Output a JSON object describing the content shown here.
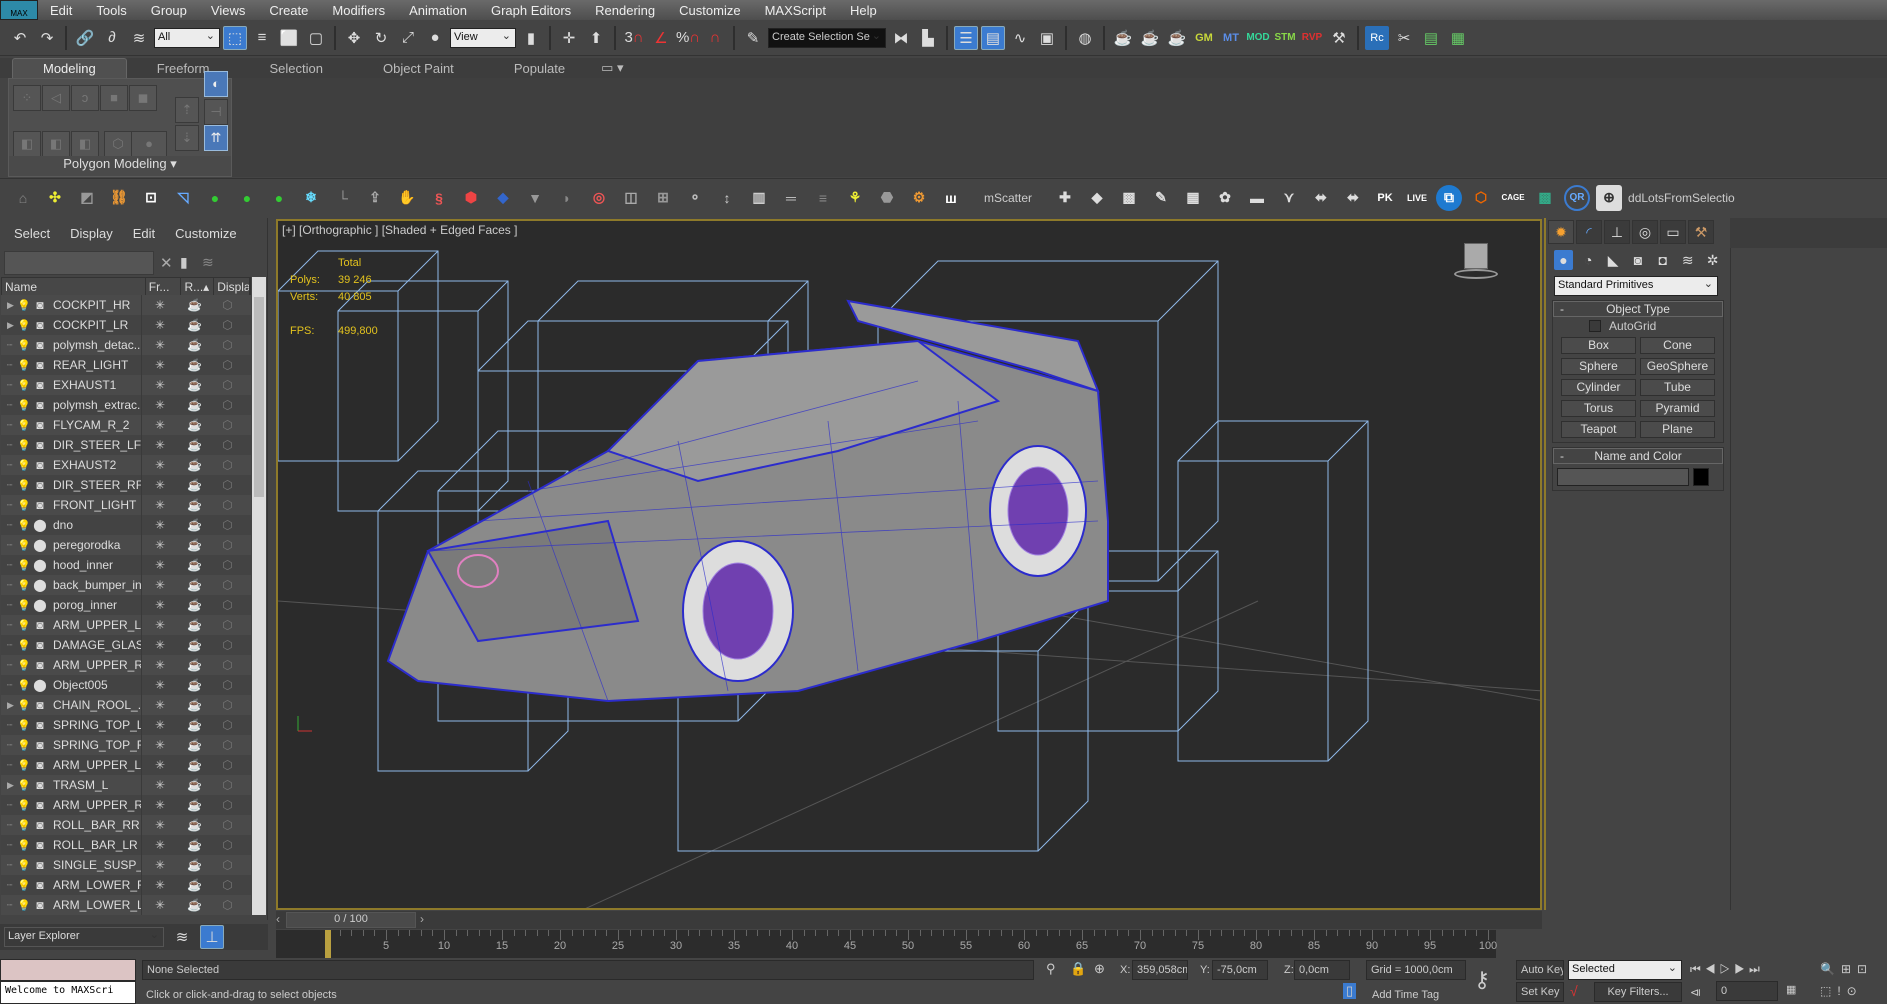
{
  "menubar": {
    "logo": "MAX",
    "items": [
      "Edit",
      "Tools",
      "Group",
      "Views",
      "Create",
      "Modifiers",
      "Animation",
      "Graph Editors",
      "Rendering",
      "Customize",
      "MAXScript",
      "Help"
    ]
  },
  "maintoolbar": {
    "selection_filter": "All",
    "ref_coord": "View",
    "named_selection": "Create Selection Se",
    "snap_labels": [
      "3",
      "%"
    ],
    "plugin_labels": [
      "GM",
      "MT",
      "MOD",
      "STM",
      "RVP",
      "Rc"
    ]
  },
  "ribbon": {
    "tabs": [
      "Modeling",
      "Freeform",
      "Selection",
      "Object Paint",
      "Populate"
    ],
    "active_tab": "Modeling",
    "panel_label": "Polygon Modeling"
  },
  "toolbar2": {
    "mscatter": "mScatter",
    "addlots": "ddLotsFromSelectio",
    "labels": [
      "PK",
      "LIVE",
      "CAGE",
      "QR"
    ]
  },
  "explorer": {
    "menu": [
      "Select",
      "Display",
      "Edit",
      "Customize"
    ],
    "columns": [
      "Name",
      "Fr...",
      "R...",
      "Displa..."
    ],
    "rows": [
      {
        "name": "COCKPIT_HR",
        "expandable": true,
        "type": "mesh"
      },
      {
        "name": "COCKPIT_LR",
        "expandable": true,
        "type": "mesh"
      },
      {
        "name": "polymsh_detac...",
        "expandable": false,
        "type": "mesh"
      },
      {
        "name": "REAR_LIGHT",
        "expandable": false,
        "type": "mesh"
      },
      {
        "name": "EXHAUST1",
        "expandable": false,
        "type": "mesh"
      },
      {
        "name": "polymsh_extrac...",
        "expandable": false,
        "type": "mesh"
      },
      {
        "name": "FLYCAM_R_2",
        "expandable": false,
        "type": "mesh"
      },
      {
        "name": "DIR_STEER_LF",
        "expandable": false,
        "type": "mesh"
      },
      {
        "name": "EXHAUST2",
        "expandable": false,
        "type": "mesh"
      },
      {
        "name": "DIR_STEER_RF",
        "expandable": false,
        "type": "mesh"
      },
      {
        "name": "FRONT_LIGHT",
        "expandable": false,
        "type": "mesh"
      },
      {
        "name": "dno",
        "expandable": false,
        "type": "sphere"
      },
      {
        "name": "peregorodka",
        "expandable": false,
        "type": "sphere"
      },
      {
        "name": "hood_inner",
        "expandable": false,
        "type": "sphere"
      },
      {
        "name": "back_bumper_iner",
        "expandable": false,
        "type": "sphere"
      },
      {
        "name": "porog_inner",
        "expandable": false,
        "type": "sphere"
      },
      {
        "name": "ARM_UPPER_LF",
        "expandable": false,
        "type": "mesh"
      },
      {
        "name": "DAMAGE_GLAS...",
        "expandable": false,
        "type": "mesh"
      },
      {
        "name": "ARM_UPPER_RF",
        "expandable": false,
        "type": "mesh"
      },
      {
        "name": "Object005",
        "expandable": false,
        "type": "sphere"
      },
      {
        "name": "CHAIN_ROOL_...",
        "expandable": true,
        "type": "mesh"
      },
      {
        "name": "SPRING_TOP_LR",
        "expandable": false,
        "type": "mesh"
      },
      {
        "name": "SPRING_TOP_RR",
        "expandable": false,
        "type": "mesh"
      },
      {
        "name": "ARM_UPPER_LR",
        "expandable": false,
        "type": "mesh"
      },
      {
        "name": "TRASM_L",
        "expandable": true,
        "type": "mesh"
      },
      {
        "name": "ARM_UPPER_RR",
        "expandable": false,
        "type": "mesh"
      },
      {
        "name": "ROLL_BAR_RR",
        "expandable": false,
        "type": "mesh"
      },
      {
        "name": "ROLL_BAR_LR",
        "expandable": false,
        "type": "mesh"
      },
      {
        "name": "SINGLE_SUSP_LR",
        "expandable": false,
        "type": "mesh"
      },
      {
        "name": "ARM_LOWER_RR",
        "expandable": false,
        "type": "mesh"
      },
      {
        "name": "ARM_LOWER_LR",
        "expandable": false,
        "type": "mesh"
      }
    ],
    "layer_explorer": "Layer Explorer"
  },
  "viewport": {
    "label": "[+] [Orthographic ] [Shaded + Edged Faces ]",
    "stats": {
      "header": "Total",
      "polys_label": "Polys:",
      "polys": "39 246",
      "verts_label": "Verts:",
      "verts": "40 805",
      "fps_label": "FPS:",
      "fps": "499,800"
    },
    "border_color": "#8e7a2a",
    "wire_color": "#8fb8e8"
  },
  "command_panel": {
    "category": "Standard Primitives",
    "object_type": {
      "title": "Object Type",
      "autogrid": "AutoGrid",
      "autogrid_checked": false,
      "buttons": [
        "Box",
        "Cone",
        "Sphere",
        "GeoSphere",
        "Cylinder",
        "Tube",
        "Torus",
        "Pyramid",
        "Teapot",
        "Plane"
      ]
    },
    "name_color": {
      "title": "Name and Color",
      "name": "",
      "color": "#000000"
    }
  },
  "timeline": {
    "frame_display": "0 / 100",
    "current": 0,
    "start": 0,
    "end": 100,
    "labels": [
      "5",
      "10",
      "15",
      "20",
      "25",
      "30",
      "35",
      "40",
      "45",
      "50",
      "55",
      "60",
      "65",
      "70",
      "75",
      "80",
      "85",
      "90",
      "95",
      "100"
    ],
    "first_label": "0"
  },
  "status": {
    "listener": "Welcome to MAXScri",
    "selection": "None Selected",
    "prompt": "Click or click-and-drag to select objects",
    "x_label": "X:",
    "x": "359,058cm",
    "y_label": "Y:",
    "y": "-75,0cm",
    "z_label": "Z:",
    "z": "0,0cm",
    "grid": "Grid = 1000,0cm",
    "add_time_tag": "Add Time Tag",
    "auto_key": "Auto Key",
    "set_key": "Set Key",
    "key_mode": "Selected",
    "key_filters": "Key Filters...",
    "frame": "0"
  }
}
